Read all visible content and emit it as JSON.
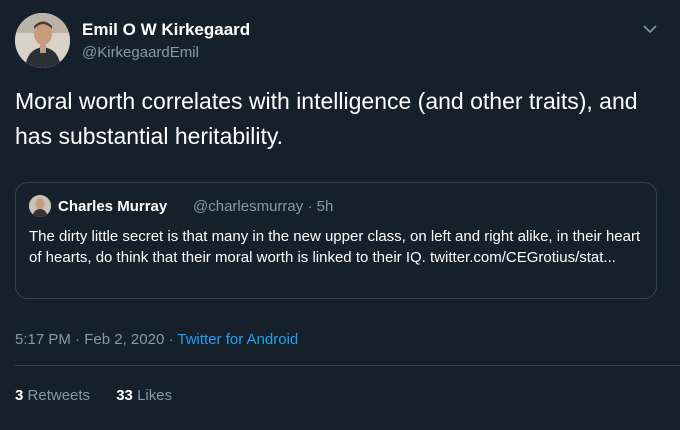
{
  "author": {
    "name": "Emil O W Kirkegaard",
    "handle": "@KirkegaardEmil"
  },
  "tweet": {
    "text": "Moral worth correlates with intelligence (and other traits), and has substantial heritability."
  },
  "quoted": {
    "name": "Charles Murray",
    "handle": "@charlesmurray",
    "separator": "·",
    "time": "5h",
    "text": "The dirty little secret is that many in the new upper class, on left and right alike, in their heart of hearts, do think that their moral worth is linked to their IQ.",
    "link": "twitter.com/CEGrotius/stat..."
  },
  "meta": {
    "time": "5:17 PM",
    "sep1": "·",
    "date": "Feb 2, 2020",
    "sep2": "·",
    "source": "Twitter for Android"
  },
  "stats": {
    "retweets_count": "3",
    "retweets_label": "Retweets",
    "likes_count": "33",
    "likes_label": "Likes"
  },
  "icons": {
    "menu": "chevron-down-icon"
  },
  "colors": {
    "background": "#15202b",
    "secondary_text": "#8899a6",
    "link": "#1da1f2",
    "border": "#38444d"
  }
}
